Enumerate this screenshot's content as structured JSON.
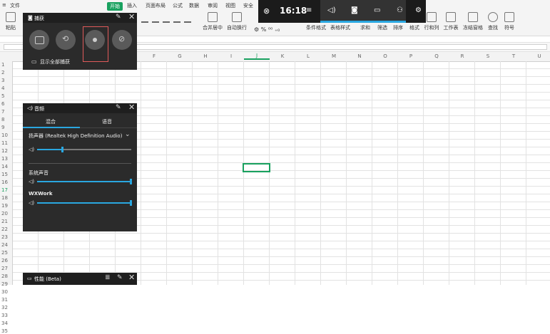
{
  "ribbon": {
    "tabs": [
      {
        "label": "文件"
      },
      {
        "label": "开始",
        "active": true
      },
      {
        "label": "插入"
      },
      {
        "label": "页面布局"
      },
      {
        "label": "公式"
      },
      {
        "label": "数据"
      },
      {
        "label": "审阅"
      },
      {
        "label": "视图"
      },
      {
        "label": "安全"
      }
    ],
    "paste_label": "粘贴",
    "buttons": [
      {
        "label": "合并居中"
      },
      {
        "label": "自动换行"
      },
      {
        "label": "条件格式"
      },
      {
        "label": "表格样式"
      },
      {
        "label": "求和"
      },
      {
        "label": "筛选"
      },
      {
        "label": "排序"
      },
      {
        "label": "格式"
      },
      {
        "label": "行和列"
      },
      {
        "label": "工作表"
      },
      {
        "label": "冻结窗格"
      },
      {
        "label": "查找"
      },
      {
        "label": "符号"
      }
    ],
    "accent_color": "#19a15f"
  },
  "grid": {
    "columns": [
      "F",
      "G",
      "H",
      "I",
      "J",
      "K",
      "L",
      "M",
      "N",
      "O",
      "P",
      "Q",
      "R",
      "S",
      "T",
      "U"
    ],
    "selected_column": "J",
    "rows": [
      "1",
      "2",
      "3",
      "4",
      "5",
      "6",
      "7",
      "8",
      "9",
      "10",
      "11",
      "12",
      "13",
      "14",
      "15",
      "16",
      "17",
      "18",
      "19",
      "20",
      "21",
      "22",
      "23",
      "24",
      "25",
      "26",
      "27",
      "28",
      "29",
      "30",
      "31",
      "32",
      "33",
      "34",
      "35"
    ],
    "selected_row": "17"
  },
  "gamebar": {
    "time": "16:18",
    "icons": [
      "xbox-icon",
      "menu-icon",
      "audio-icon",
      "capture-icon",
      "performance-icon",
      "xbox-social-icon",
      "settings-icon"
    ]
  },
  "capture": {
    "title": "捕获",
    "show_all_captures": "显示全部捕获",
    "buttons": [
      "screenshot-button",
      "record-last-button",
      "record-button",
      "mic-button"
    ]
  },
  "audio": {
    "title": "音频",
    "tabs": [
      "混合",
      "语音"
    ],
    "active_tab": "混合",
    "device": "扬声器 (Realtek High Definition Audio)",
    "device_volume": 0.27,
    "apps": [
      {
        "name": "系统声音",
        "volume": 1.0
      },
      {
        "name": "WXWork",
        "volume": 1.0
      }
    ]
  },
  "performance": {
    "title": "性能 (Beta)"
  }
}
